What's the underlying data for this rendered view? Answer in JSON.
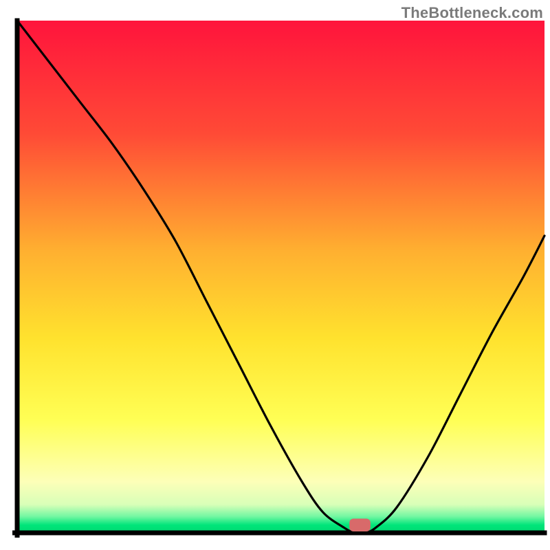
{
  "watermark": "TheBottleneck.com",
  "chart_data": {
    "type": "line",
    "title": "",
    "xlabel": "",
    "ylabel": "",
    "xlim": [
      0,
      100
    ],
    "ylim": [
      0,
      100
    ],
    "x": [
      0,
      6,
      12,
      18,
      24,
      30,
      36,
      42,
      48,
      54,
      58,
      62,
      64,
      66,
      68,
      72,
      78,
      84,
      90,
      96,
      100
    ],
    "values": [
      100,
      92,
      84,
      76,
      67,
      57,
      45,
      33,
      21,
      10,
      4,
      1,
      0,
      0,
      1,
      5,
      15,
      27,
      39,
      50,
      58
    ],
    "notch": {
      "x": 65,
      "width": 4,
      "height": 2.5,
      "color": "#d86a6a"
    },
    "gradient_stops": [
      {
        "offset": 0.0,
        "color": "#ff143c"
      },
      {
        "offset": 0.22,
        "color": "#ff4a36"
      },
      {
        "offset": 0.45,
        "color": "#ffb030"
      },
      {
        "offset": 0.62,
        "color": "#ffe22e"
      },
      {
        "offset": 0.78,
        "color": "#ffff55"
      },
      {
        "offset": 0.9,
        "color": "#fdffb8"
      },
      {
        "offset": 0.945,
        "color": "#d8ffb8"
      },
      {
        "offset": 0.968,
        "color": "#73f7a2"
      },
      {
        "offset": 0.985,
        "color": "#00e57a"
      },
      {
        "offset": 1.0,
        "color": "#00d870"
      }
    ],
    "axes_color": "#000000",
    "line_color": "#000000"
  }
}
